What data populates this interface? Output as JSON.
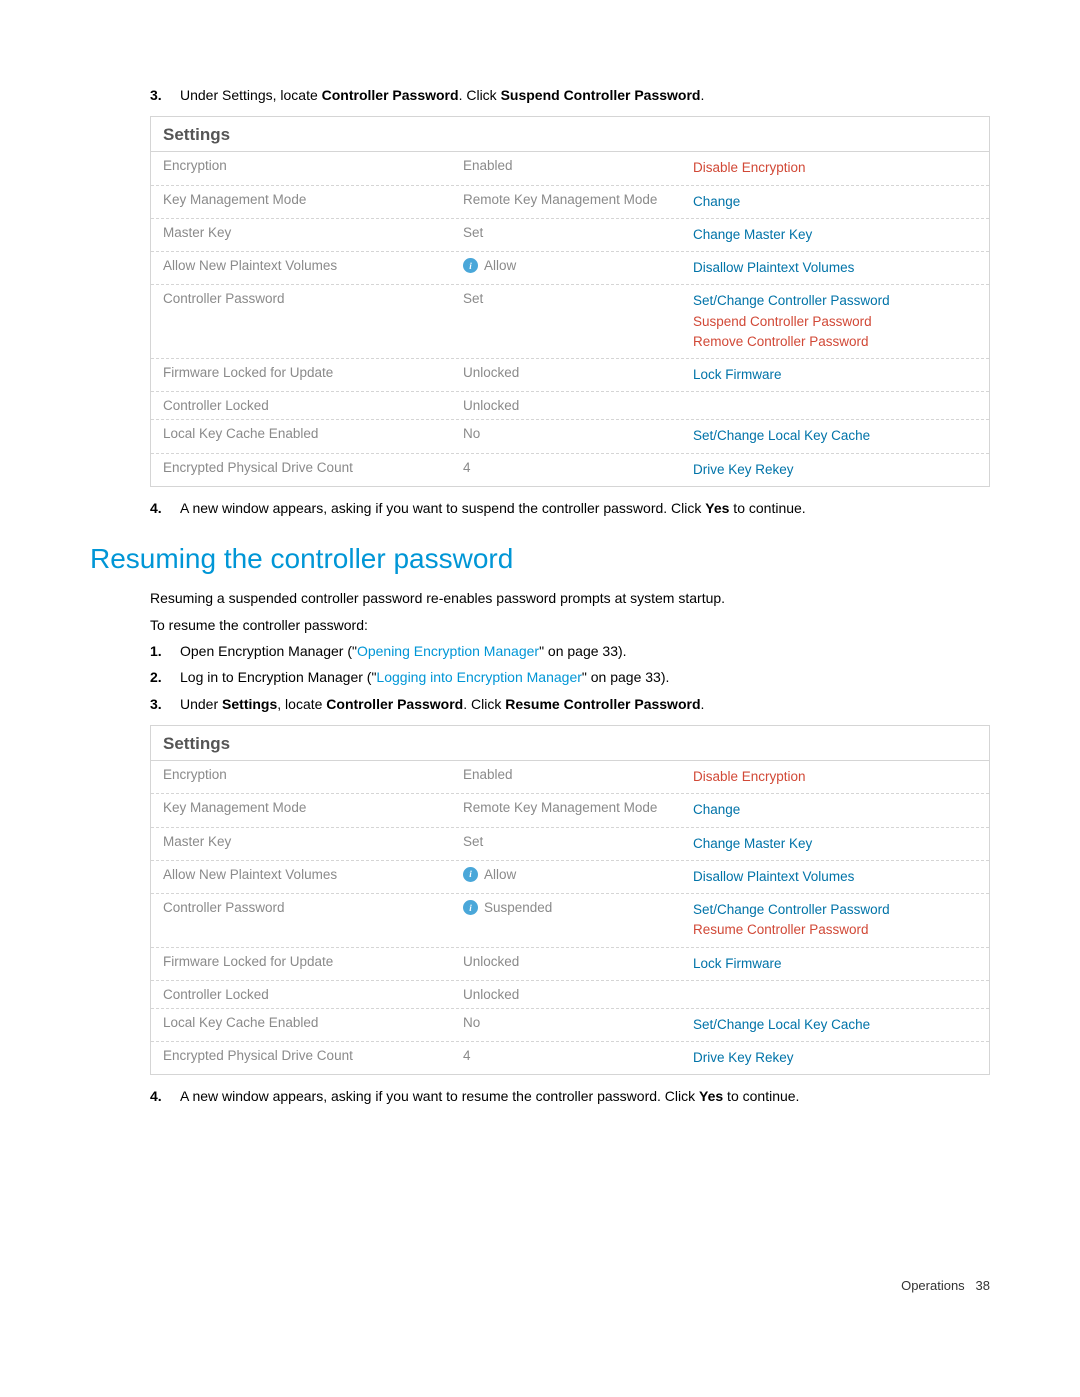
{
  "step3": {
    "num": "3.",
    "prefix": "Under Settings, locate ",
    "bold1": "Controller Password",
    "mid": ". Click ",
    "bold2": "Suspend Controller Password",
    "suffix": "."
  },
  "panel1": {
    "title": "Settings",
    "rows": [
      {
        "label": "Encryption",
        "value": "Enabled",
        "info": false,
        "actions": [
          {
            "text": "Disable Encryption",
            "red": true
          }
        ]
      },
      {
        "label": "Key Management Mode",
        "value": "Remote Key Management Mode",
        "info": false,
        "actions": [
          {
            "text": "Change",
            "red": false
          }
        ]
      },
      {
        "label": "Master Key",
        "value": "Set",
        "info": false,
        "actions": [
          {
            "text": "Change Master Key",
            "red": false
          }
        ]
      },
      {
        "label": "Allow New Plaintext Volumes",
        "value": "Allow",
        "info": true,
        "actions": [
          {
            "text": "Disallow Plaintext Volumes",
            "red": false
          }
        ]
      },
      {
        "label": "Controller Password",
        "value": "Set",
        "info": false,
        "actions": [
          {
            "text": "Set/Change Controller Password",
            "red": false
          },
          {
            "text": "Suspend Controller Password",
            "red": true
          },
          {
            "text": "Remove Controller Password",
            "red": true
          }
        ]
      },
      {
        "label": "Firmware Locked for Update",
        "value": "Unlocked",
        "info": false,
        "actions": [
          {
            "text": "Lock Firmware",
            "red": false
          }
        ]
      },
      {
        "label": "Controller Locked",
        "value": "Unlocked",
        "info": false,
        "actions": []
      },
      {
        "label": "Local Key Cache Enabled",
        "value": "No",
        "info": false,
        "actions": [
          {
            "text": "Set/Change Local Key Cache",
            "red": false
          }
        ]
      },
      {
        "label": "Encrypted Physical Drive Count",
        "value": "4",
        "info": false,
        "actions": [
          {
            "text": "Drive Key Rekey",
            "red": false
          }
        ]
      }
    ]
  },
  "step4": {
    "num": "4.",
    "text": "A new window appears, asking if you want to suspend the controller password. Click ",
    "bold": "Yes",
    "suffix": " to continue."
  },
  "heading": "Resuming the controller password",
  "para1": "Resuming a suspended controller password re-enables password prompts at system startup.",
  "para2": "To resume the controller password:",
  "stepB1": {
    "num": "1.",
    "prefix": "Open Encryption Manager (\"",
    "link": "Opening Encryption Manager",
    "suffix": "\" on page 33)."
  },
  "stepB2": {
    "num": "2.",
    "prefix": "Log in to Encryption Manager (\"",
    "link": "Logging into Encryption Manager",
    "suffix": "\" on page 33)."
  },
  "stepB3": {
    "num": "3.",
    "prefix": "Under ",
    "bold0": "Settings",
    "mid0": ", locate ",
    "bold1": "Controller Password",
    "mid1": ". Click ",
    "bold2": "Resume Controller Password",
    "suffix": "."
  },
  "panel2": {
    "title": "Settings",
    "rows": [
      {
        "label": "Encryption",
        "value": "Enabled",
        "info": false,
        "actions": [
          {
            "text": "Disable Encryption",
            "red": true
          }
        ]
      },
      {
        "label": "Key Management Mode",
        "value": "Remote Key Management Mode",
        "info": false,
        "actions": [
          {
            "text": "Change",
            "red": false
          }
        ]
      },
      {
        "label": "Master Key",
        "value": "Set",
        "info": false,
        "actions": [
          {
            "text": "Change Master Key",
            "red": false
          }
        ]
      },
      {
        "label": "Allow New Plaintext Volumes",
        "value": "Allow",
        "info": true,
        "actions": [
          {
            "text": "Disallow Plaintext Volumes",
            "red": false
          }
        ]
      },
      {
        "label": "Controller Password",
        "value": "Suspended",
        "info": true,
        "actions": [
          {
            "text": "Set/Change Controller Password",
            "red": false
          },
          {
            "text": "Resume Controller Password",
            "red": true
          }
        ]
      },
      {
        "label": "Firmware Locked for Update",
        "value": "Unlocked",
        "info": false,
        "actions": [
          {
            "text": "Lock Firmware",
            "red": false
          }
        ]
      },
      {
        "label": "Controller Locked",
        "value": "Unlocked",
        "info": false,
        "actions": []
      },
      {
        "label": "Local Key Cache Enabled",
        "value": "No",
        "info": false,
        "actions": [
          {
            "text": "Set/Change Local Key Cache",
            "red": false
          }
        ]
      },
      {
        "label": "Encrypted Physical Drive Count",
        "value": "4",
        "info": false,
        "actions": [
          {
            "text": "Drive Key Rekey",
            "red": false
          }
        ]
      }
    ]
  },
  "stepB4": {
    "num": "4.",
    "text": "A new window appears, asking if you want to resume the controller password. Click ",
    "bold": "Yes",
    "suffix": " to continue."
  },
  "footer": {
    "section": "Operations",
    "page": "38"
  }
}
